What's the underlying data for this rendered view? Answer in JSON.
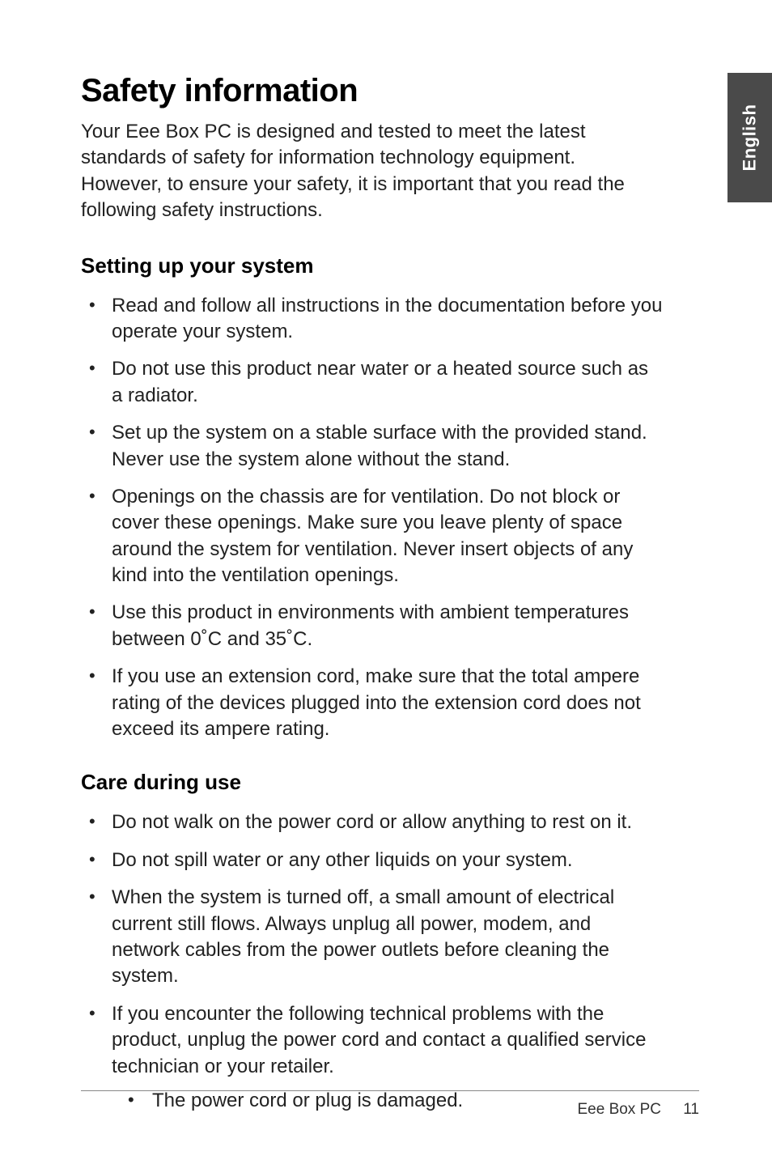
{
  "side_tab": {
    "label": "English"
  },
  "title": "Safety information",
  "intro": "Your Eee Box PC is designed and tested to meet the latest standards of safety for information technology equipment. However, to ensure your safety, it is important that you read the following safety instructions.",
  "section1": {
    "heading": "Setting up your system",
    "items": [
      "Read and follow all instructions in the documentation before you operate your system.",
      "Do not use this product near water or a heated source such as a radiator.",
      "Set up the system on a stable surface with the provided stand. Never use the system alone without the stand.",
      "Openings on the chassis are for ventilation. Do not block or cover these openings. Make sure you leave plenty of space around the system for ventilation. Never insert objects of any kind into the ventilation openings.",
      "Use this product in environments with ambient temperatures between 0˚C and 35˚C.",
      "If you use an extension cord, make sure that the total ampere rating of the devices plugged into the extension cord does not exceed its ampere rating."
    ]
  },
  "section2": {
    "heading": "Care during use",
    "items": [
      "Do not walk on the power cord or allow anything to rest on it.",
      "Do not spill water or any other liquids on your system.",
      "When the system is turned off, a small amount of electrical current still flows. Always unplug all power, modem, and network cables from the power outlets before cleaning the system.",
      "If you encounter the following technical problems with the product, unplug the power cord and contact a qualified service technician or your retailer."
    ],
    "subitems": [
      "The power cord or plug is damaged."
    ]
  },
  "footer": {
    "product": "Eee Box PC",
    "page": "11"
  }
}
